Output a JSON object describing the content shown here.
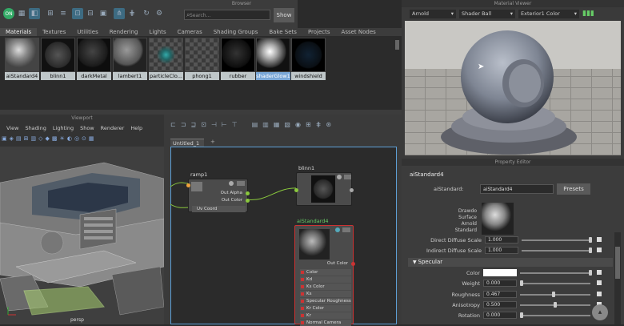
{
  "toolbar": {
    "search_placeholder": "Search...",
    "show_label": "Show"
  },
  "browser": {
    "title": "Browser",
    "tabs": [
      "Materials",
      "Textures",
      "Utilities",
      "Rendering",
      "Lights",
      "Cameras",
      "Shading Groups",
      "Bake Sets",
      "Projects",
      "Asset Nodes"
    ],
    "materials": [
      "aiStandard4",
      "blinn1",
      "darkMetal",
      "lambert1",
      "particleClo...",
      "phong1",
      "rubber",
      "shaderGlow1",
      "windshield"
    ]
  },
  "viewport": {
    "title": "Viewport",
    "menu": [
      "View",
      "Shading",
      "Lighting",
      "Show",
      "Renderer",
      "Help"
    ],
    "camera": "persp"
  },
  "hypershade": {
    "tab": "Untitled_1",
    "tab_add": "+",
    "nodes": {
      "ramp": {
        "name": "ramp1",
        "out_alpha": "Out Alpha",
        "out_color": "Out Color",
        "uv": "Uv Coord"
      },
      "blinn": {
        "name": "blinn1"
      },
      "aistd": {
        "name": "aiStandard4",
        "out_color": "Out Color",
        "ports": [
          "Color",
          "Kd",
          "Ks Color",
          "Ks",
          "Specular Roughness",
          "Kr Color",
          "Kr",
          "Normal Camera"
        ]
      }
    }
  },
  "material_viewer": {
    "title": "Material Viewer",
    "renderer": "Arnold",
    "shape": "Shader Ball",
    "env": "Exterior1 Color"
  },
  "property_editor": {
    "title": "Property Editor",
    "node_name": "aiStandard4",
    "type_label": "aiStandard:",
    "name_value": "aiStandard4",
    "presets": "Presets",
    "swatch_caption": [
      "Drawdo",
      "Surface",
      "Arnold",
      "Standard"
    ],
    "direct_diffuse": {
      "label": "Direct Diffuse Scale",
      "value": "1.000"
    },
    "indirect_diffuse": {
      "label": "Indirect Diffuse Scale",
      "value": "1.000"
    },
    "section": "Specular",
    "color_label": "Color",
    "weight": {
      "label": "Weight",
      "value": "0.000"
    },
    "roughness": {
      "label": "Roughness",
      "value": "0.467"
    },
    "anisotropy": {
      "label": "Anisotropy",
      "value": "0.500"
    },
    "rotation": {
      "label": "Rotation",
      "value": "0.000"
    }
  }
}
